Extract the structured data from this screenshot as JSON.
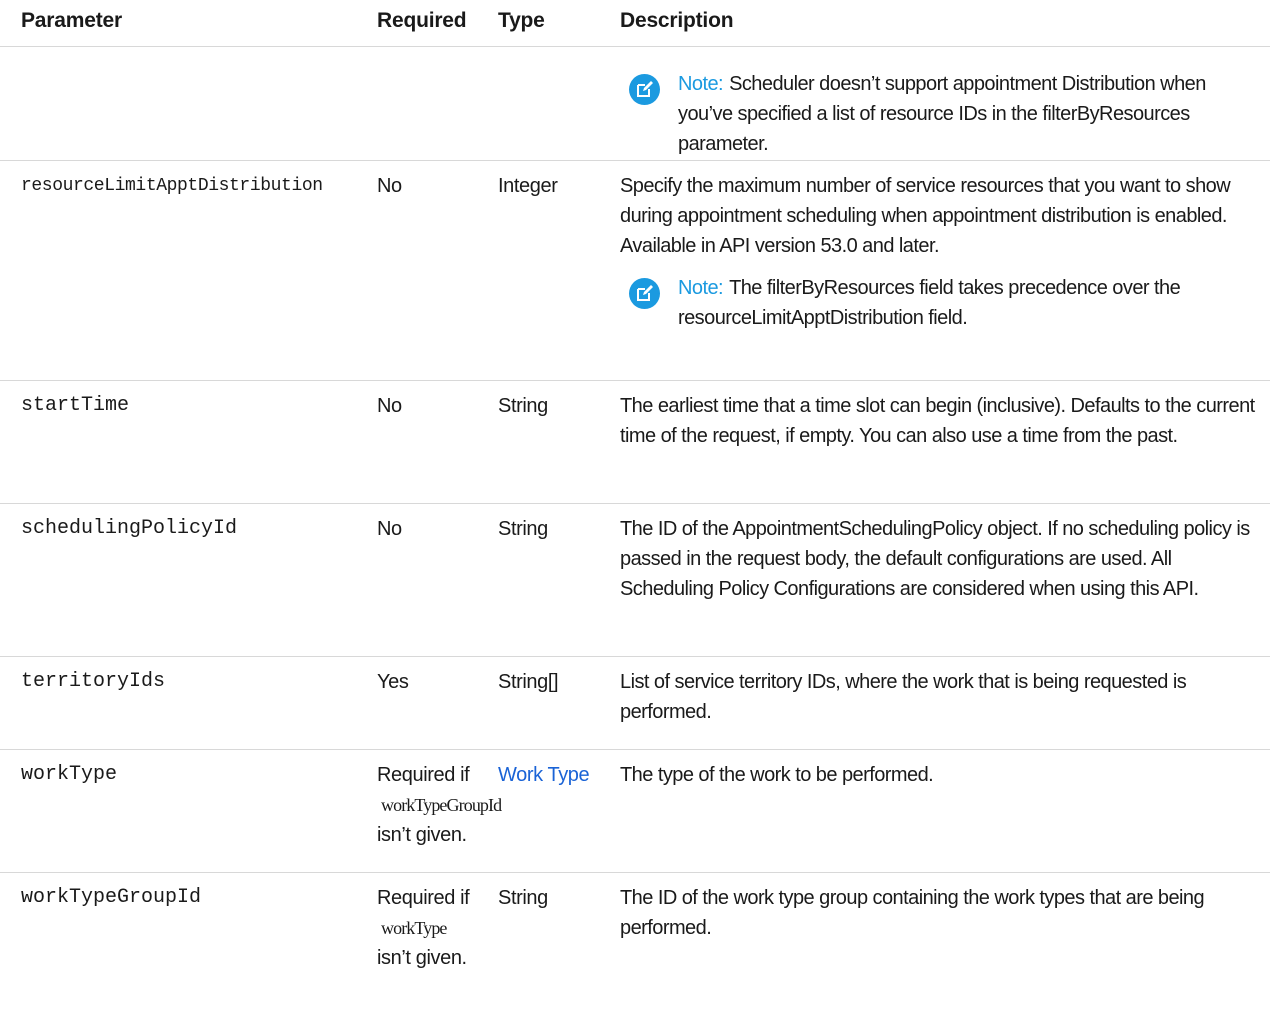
{
  "columns": {
    "parameter": "Parameter",
    "required": "Required",
    "type": "Type",
    "description": "Description"
  },
  "rows": [
    {
      "parameter": "",
      "required": "",
      "type": "",
      "notes": [
        {
          "label": "Note:",
          "text": "Scheduler doesn’t support appointment Distribution when you’ve specified a list of resource IDs in the filterByResources parameter."
        }
      ]
    },
    {
      "parameter": "resourceLimitApptDistribution",
      "required": "No",
      "type": "Integer",
      "description": "Specify the maximum number of service resources that you want to show during appointment scheduling when appointment distribution is enabled. Available in API version 53.0 and later.",
      "notes": [
        {
          "label": "Note:",
          "text": "The filterByResources field takes precedence over the resourceLimitApptDistribution field."
        }
      ]
    },
    {
      "parameter": "startTime",
      "required": "No",
      "type": "String",
      "description": "The earliest time that a time slot can begin (inclusive). Defaults to the current time of the request, if empty. You can also use a time from the past."
    },
    {
      "parameter": "schedulingPolicyId",
      "required": "No",
      "type": "String",
      "description": "The ID of the AppointmentSchedulingPolicy object. If no scheduling policy is passed in the request body, the default configurations are used. All Scheduling Policy Configurations are considered when using this API."
    },
    {
      "parameter": "territoryIds",
      "required": "Yes",
      "type": "String[]",
      "description": "List of service territory IDs, where the work that is being requested is performed."
    },
    {
      "parameter": "workType",
      "required_prefix": "Required if",
      "required_code": "workTypeGroupId",
      "required_suffix": "isn’t given.",
      "type": "Work Type",
      "type_is_link": true,
      "description": "The type of the work to be performed."
    },
    {
      "parameter": "workTypeGroupId",
      "required_prefix": "Required if",
      "required_code": "workType",
      "required_suffix": "isn’t given.",
      "type": "String",
      "description": "The ID of the work type group containing the work types that are being performed."
    }
  ],
  "colors": {
    "note_accent": "#1b9ae0",
    "link": "#1a63d6",
    "divider": "#d8d8d8"
  },
  "icons": {
    "note": "note-edit-icon"
  }
}
